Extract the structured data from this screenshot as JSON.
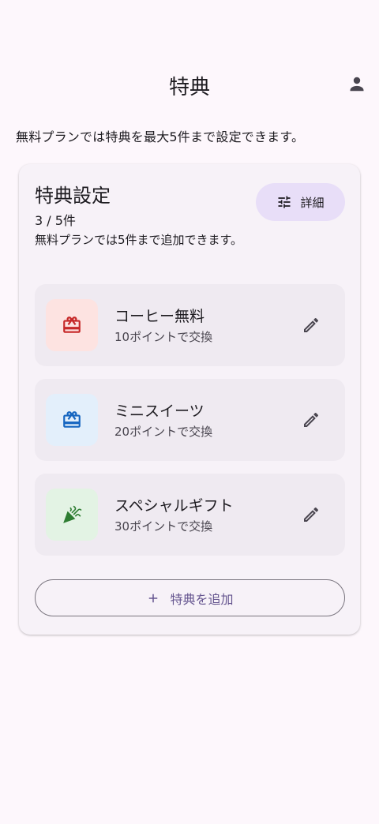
{
  "app_bar": {
    "title": "特典",
    "account_icon": "account-icon"
  },
  "intro_text": "無料プランでは特典を最大5件まで設定できます。",
  "card": {
    "title": "特典設定",
    "count": "3 / 5件",
    "note": "無料プランでは5件まで追加できます。",
    "detail_button": {
      "icon": "tune-icon",
      "label": "詳細"
    },
    "rewards": [
      {
        "name": "コーヒー無料",
        "cost": "10ポイントで交換",
        "icon": "gift-icon",
        "thumb_color": "#fde3e1",
        "icon_color": "#c62828"
      },
      {
        "name": "ミニスイーツ",
        "cost": "20ポイントで交換",
        "icon": "gift-icon",
        "thumb_color": "#e3effb",
        "icon_color": "#1565c0"
      },
      {
        "name": "スペシャルギフト",
        "cost": "30ポイントで交換",
        "icon": "celebration-icon",
        "thumb_color": "#e3f3e4",
        "icon_color": "#2e7d32"
      }
    ],
    "edit_icon": "edit-icon",
    "add_button": {
      "icon": "plus-icon",
      "label": "特典を追加"
    }
  },
  "colors": {
    "background": "#fdf7fc",
    "card": "#f7f2f8",
    "item": "#efeaf1",
    "tonal_button": "#e8def8",
    "primary": "#65558f"
  }
}
